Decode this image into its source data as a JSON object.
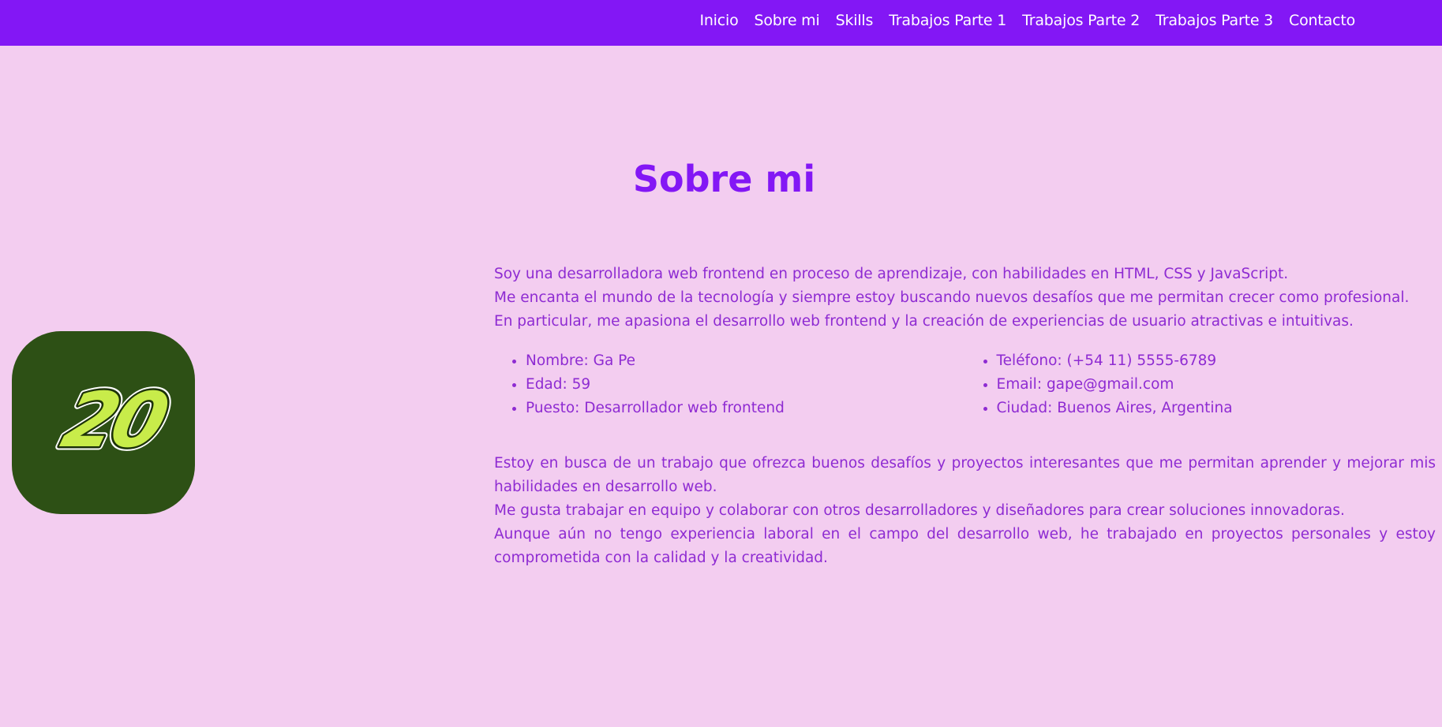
{
  "nav": {
    "items": [
      {
        "label": "Inicio"
      },
      {
        "label": "Sobre mi"
      },
      {
        "label": "Skills"
      },
      {
        "label": "Trabajos Parte 1"
      },
      {
        "label": "Trabajos Parte 2"
      },
      {
        "label": "Trabajos Parte 3"
      },
      {
        "label": "Contacto"
      }
    ]
  },
  "logo": {
    "text": "20"
  },
  "about": {
    "title": "Sobre mi",
    "intro": [
      "Soy una desarrolladora web frontend en proceso de aprendizaje, con habilidades en HTML, CSS y JavaScript.",
      "Me encanta el mundo de la tecnología y siempre estoy buscando nuevos desafíos que me permitan crecer como profesional.",
      "En particular, me apasiona el desarrollo web frontend y la creación de experiencias de usuario atractivas e intuitivas."
    ],
    "details_left": [
      "Nombre: Ga Pe",
      "Edad: 59",
      "Puesto: Desarrollador web frontend"
    ],
    "details_right": [
      "Teléfono: (+54 11) 5555-6789",
      "Email: gape@gmail.com",
      "Ciudad: Buenos Aires, Argentina"
    ],
    "closing": [
      "Estoy en busca de un trabajo que ofrezca buenos desafíos y proyectos interesantes que me permitan aprender y mejorar mis habilidades en desarrollo web.",
      "Me gusta trabajar en equipo y colaborar con otros desarrolladores y diseñadores para crear soluciones innovadoras.",
      "Aunque aún no tengo experiencia laboral en el campo del desarrollo web, he trabajado en proyectos personales y estoy comprometida con la calidad y la creatividad."
    ]
  },
  "colors": {
    "nav_bg": "#8317f5",
    "page_bg": "#f3cdf0",
    "title": "#8317f5",
    "text": "#8e2bd2",
    "logo_bg": "#2d5015",
    "logo_fill": "#c8ec4a"
  }
}
